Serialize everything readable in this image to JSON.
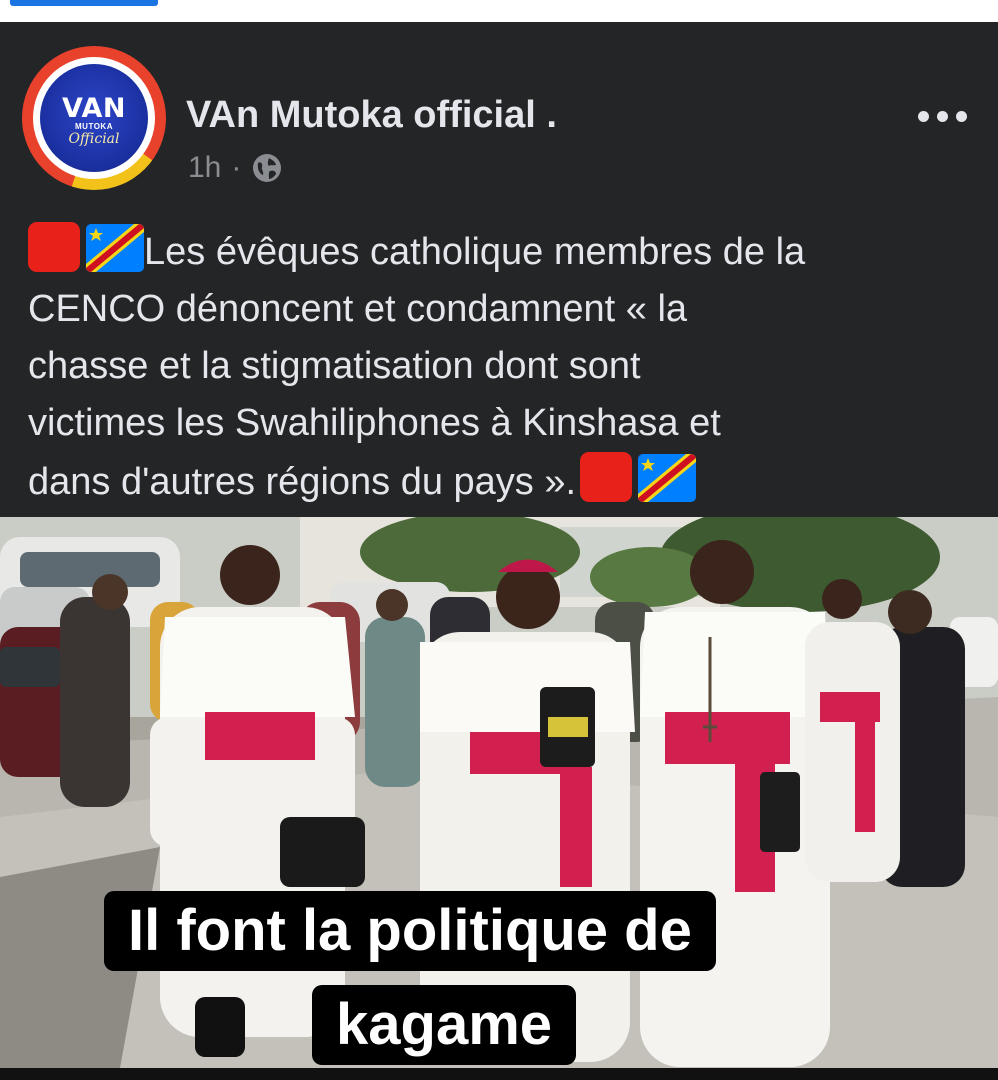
{
  "post": {
    "page_name": "VAn Mutoka official .",
    "time": "1h",
    "separator": "·",
    "avatar": {
      "word": "VAN",
      "sub": "MUTOKA",
      "script": "Official"
    },
    "icons": {
      "audience": "globe-icon",
      "menu": "more-horizontal-icon",
      "emoji_1": "red-square-emoji",
      "emoji_2": "drc-flag-emoji"
    },
    "text": {
      "line1": "Les évêques catholique membres de la",
      "line2": "CENCO dénoncent et condamnent « la",
      "line3": "chasse et la stigmatisation dont sont",
      "line4": "victimes les Swahiliphones à Kinshasa et",
      "line5": "dans d'autres régions du pays »."
    },
    "photo_caption": {
      "line1": "Il font la politique de",
      "line2": "kagame"
    }
  },
  "colors": {
    "background": "#242526",
    "text": "#e4e6eb",
    "meta": "#8a8d91",
    "emoji_red": "#e8221b",
    "flag_blue": "#007fff",
    "flag_yellow": "#f7d618",
    "flag_red": "#ce1021"
  }
}
